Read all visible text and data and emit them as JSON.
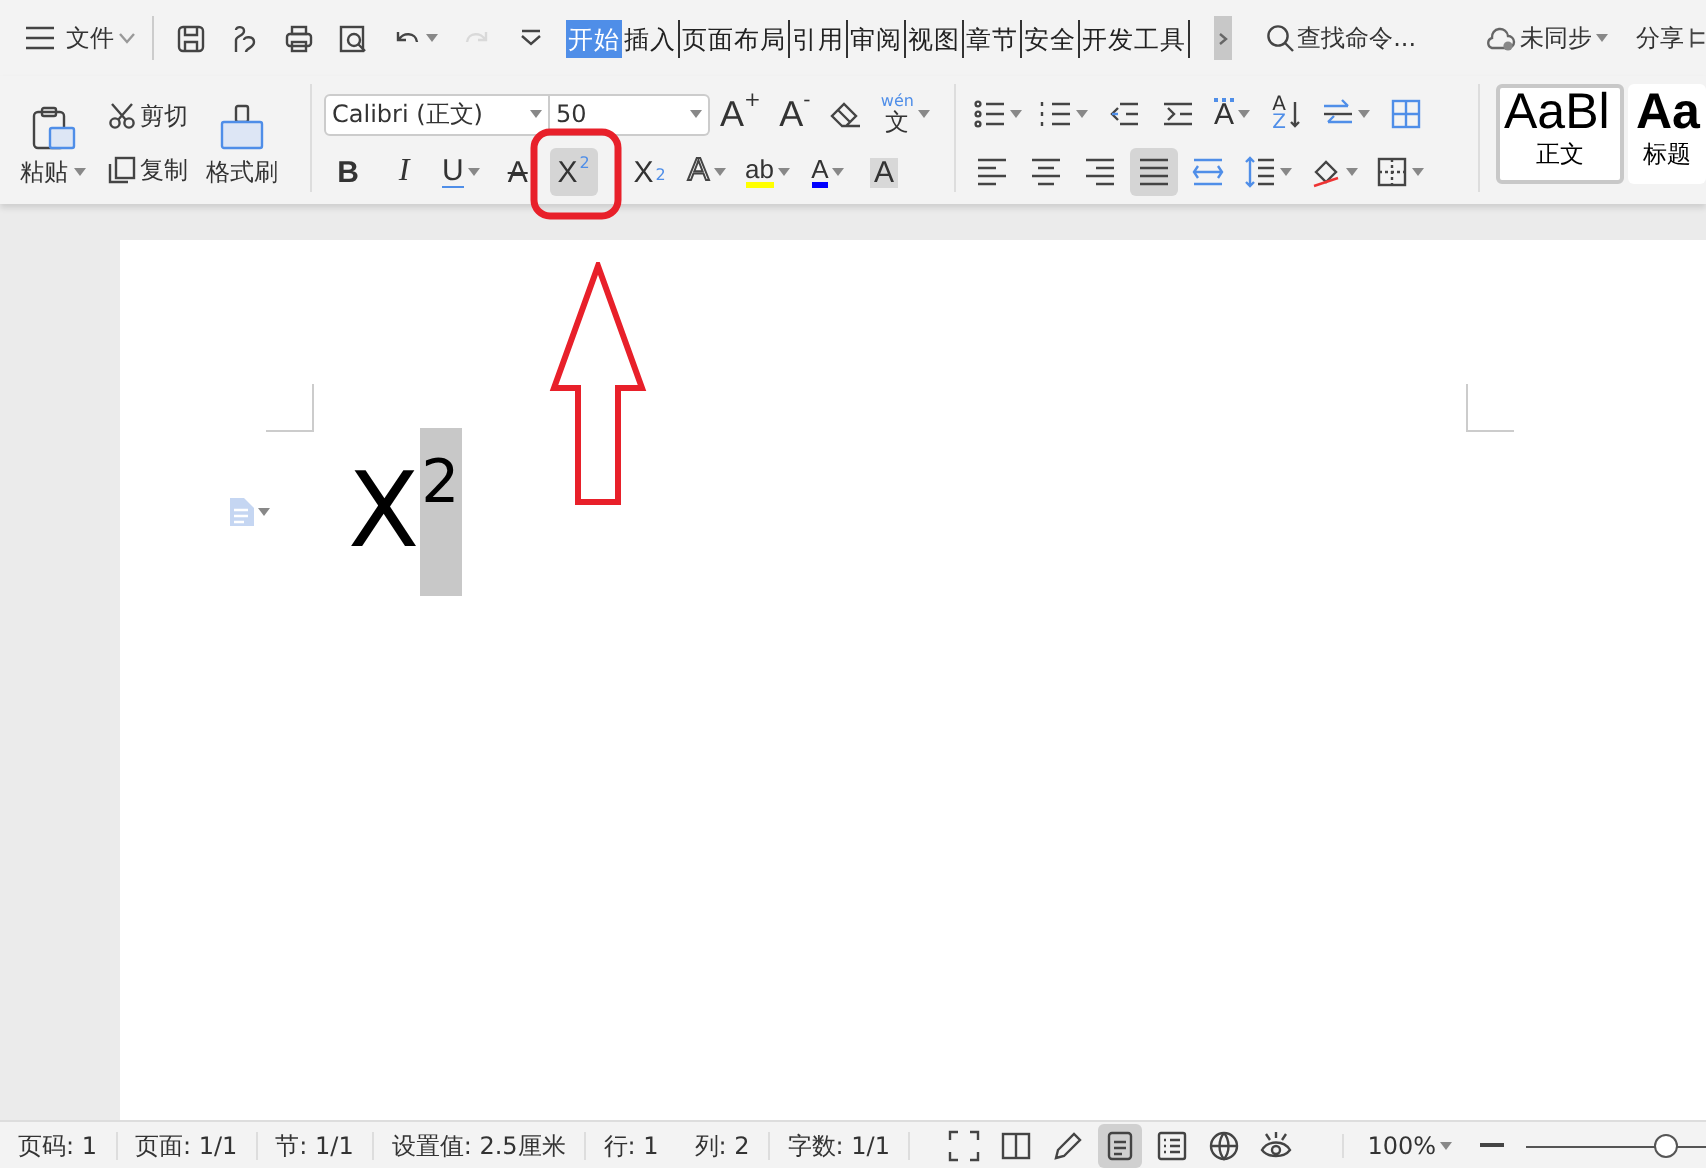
{
  "menu": {
    "label": "文件"
  },
  "quick_access": [
    {
      "kind": "save"
    },
    {
      "kind": "format"
    },
    {
      "kind": "print"
    },
    {
      "kind": "preview"
    },
    {
      "kind": "undo",
      "dropdown": true
    },
    {
      "kind": "redo",
      "disabled": true
    },
    {
      "kind": "more"
    }
  ],
  "tabs": [
    {
      "label": "开始",
      "selected": true
    },
    {
      "label": "插入",
      "selected": false
    },
    {
      "label": "页面布局",
      "selected": false
    },
    {
      "label": "引用",
      "selected": false
    },
    {
      "label": "审阅",
      "selected": false
    },
    {
      "label": "视图",
      "selected": false
    },
    {
      "label": "章节",
      "selected": false
    },
    {
      "label": "安全",
      "selected": false
    },
    {
      "label": "开发工具",
      "selected": false
    }
  ],
  "search": {
    "placeholder": "查找命令..."
  },
  "sync": {
    "label": "未同步"
  },
  "share": {
    "label": "分享"
  },
  "clipboard": {
    "paste": "粘贴",
    "cut": "剪切",
    "copy": "复制",
    "format_painter": "格式刷"
  },
  "font": {
    "name": "Calibri (正文)",
    "size": "50"
  },
  "font_row1": [
    {
      "kind": "grow",
      "glyph": "A",
      "mark": "+"
    },
    {
      "kind": "shrink",
      "glyph": "A",
      "mark": "-"
    },
    {
      "kind": "eraser"
    },
    {
      "kind": "pinyin",
      "glyph": "文",
      "mark": "wén",
      "dropdown": true
    }
  ],
  "font_row2": [
    {
      "kind": "bold",
      "glyph": "B",
      "selected": false
    },
    {
      "kind": "italic",
      "glyph": "I",
      "selected": false
    },
    {
      "kind": "underline",
      "glyph": "U",
      "dropdown": true,
      "selected": false
    },
    {
      "kind": "strike",
      "glyph": "A",
      "selected": false
    },
    {
      "kind": "superscript",
      "glyph": "X",
      "mark": "2",
      "selected": true
    },
    {
      "kind": "subscript",
      "glyph": "X",
      "mark": "2",
      "selected": false
    },
    {
      "kind": "outline",
      "glyph": "A",
      "dropdown": true,
      "selected": false
    },
    {
      "kind": "highlight",
      "glyph": "ab",
      "dropdown": true,
      "color": "#ffff00",
      "selected": false
    },
    {
      "kind": "color",
      "glyph": "A",
      "dropdown": true,
      "color": "#0000ff",
      "selected": false
    },
    {
      "kind": "shade",
      "glyph": "A",
      "selected": false
    }
  ],
  "para_row1": [
    {
      "kind": "bullets",
      "dropdown": true
    },
    {
      "kind": "numbering",
      "dropdown": true
    },
    {
      "kind": "outdent"
    },
    {
      "kind": "indent"
    },
    {
      "kind": "direction",
      "glyph": "A",
      "dropdown": true
    },
    {
      "kind": "sort",
      "top": "A",
      "bottom": "Z"
    },
    {
      "kind": "swap",
      "dropdown": true
    },
    {
      "kind": "table"
    }
  ],
  "para_row2": [
    {
      "kind": "left",
      "selected": false
    },
    {
      "kind": "center",
      "selected": false
    },
    {
      "kind": "right",
      "selected": false
    },
    {
      "kind": "justify",
      "selected": true
    },
    {
      "kind": "distribute",
      "selected": false
    },
    {
      "kind": "spacing",
      "dropdown": true,
      "selected": false
    },
    {
      "kind": "fill",
      "dropdown": true,
      "selected": false
    },
    {
      "kind": "borders",
      "dropdown": true,
      "selected": false
    }
  ],
  "styles": [
    {
      "preview": "AaBl",
      "label": "正文",
      "selected": true,
      "bold": false
    },
    {
      "preview": "Aa",
      "label": "标题",
      "selected": false,
      "bold": true
    }
  ],
  "document": {
    "text": "X",
    "superscript": "2",
    "superscript_selected": true
  },
  "annotation": {
    "highlight_box": {
      "color": "#e8202a"
    },
    "arrow": {
      "color": "#e8202a"
    }
  },
  "status_bar": [
    "页码: 1",
    "页面: 1/1",
    "节: 1/1",
    "设置值: 2.5厘米",
    "行: 1",
    "列: 2",
    "字数: 1/1"
  ],
  "views": [
    {
      "kind": "fullscreen",
      "selected": false
    },
    {
      "kind": "book",
      "selected": false
    },
    {
      "kind": "pen",
      "selected": false
    },
    {
      "kind": "page",
      "selected": true
    },
    {
      "kind": "outline",
      "selected": false
    },
    {
      "kind": "web",
      "selected": false
    },
    {
      "kind": "eye",
      "selected": false
    }
  ],
  "zoom": {
    "label": "100%",
    "level": 0.78
  }
}
